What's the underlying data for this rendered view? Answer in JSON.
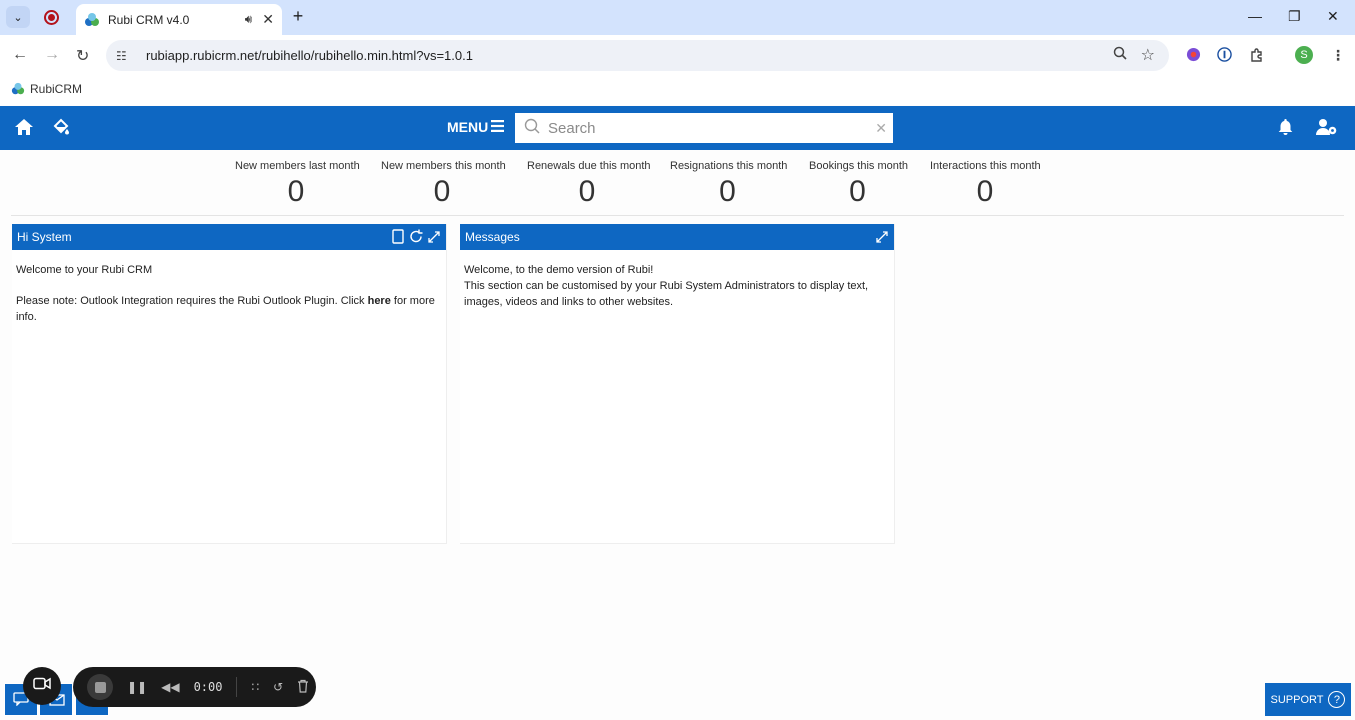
{
  "browser": {
    "tab_title": "Rubi CRM v4.0",
    "url": "rubiapp.rubicrm.net/rubihello/rubihello.min.html?vs=1.0.1",
    "bookmark_label": "RubiCRM",
    "profile_initial": "S"
  },
  "header": {
    "menu_label": "MENU",
    "search_placeholder": "Search"
  },
  "stats": [
    {
      "label": "New members last month",
      "value": "0"
    },
    {
      "label": "New members this month",
      "value": "0"
    },
    {
      "label": "Renewals due this month",
      "value": "0"
    },
    {
      "label": "Resignations this month",
      "value": "0"
    },
    {
      "label": "Bookings this month",
      "value": "0"
    },
    {
      "label": "Interactions this month",
      "value": "0"
    }
  ],
  "panels": {
    "hi": {
      "title": "Hi System",
      "welcome": "Welcome to your Rubi CRM",
      "note_before": "Please note: Outlook Integration requires the Rubi Outlook Plugin. Click ",
      "note_link": "here",
      "note_after": " for more info."
    },
    "messages": {
      "title": "Messages",
      "line1": "Welcome, to the demo version of Rubi!",
      "line2": "This section can be customised by your Rubi System Administrators to display text, images, videos and links to other websites."
    }
  },
  "recorder": {
    "time": "0:00"
  },
  "support_label": "SUPPORT",
  "colors": {
    "brand_blue": "#0e67c2",
    "chrome_tab_bar": "#d3e3fd"
  }
}
